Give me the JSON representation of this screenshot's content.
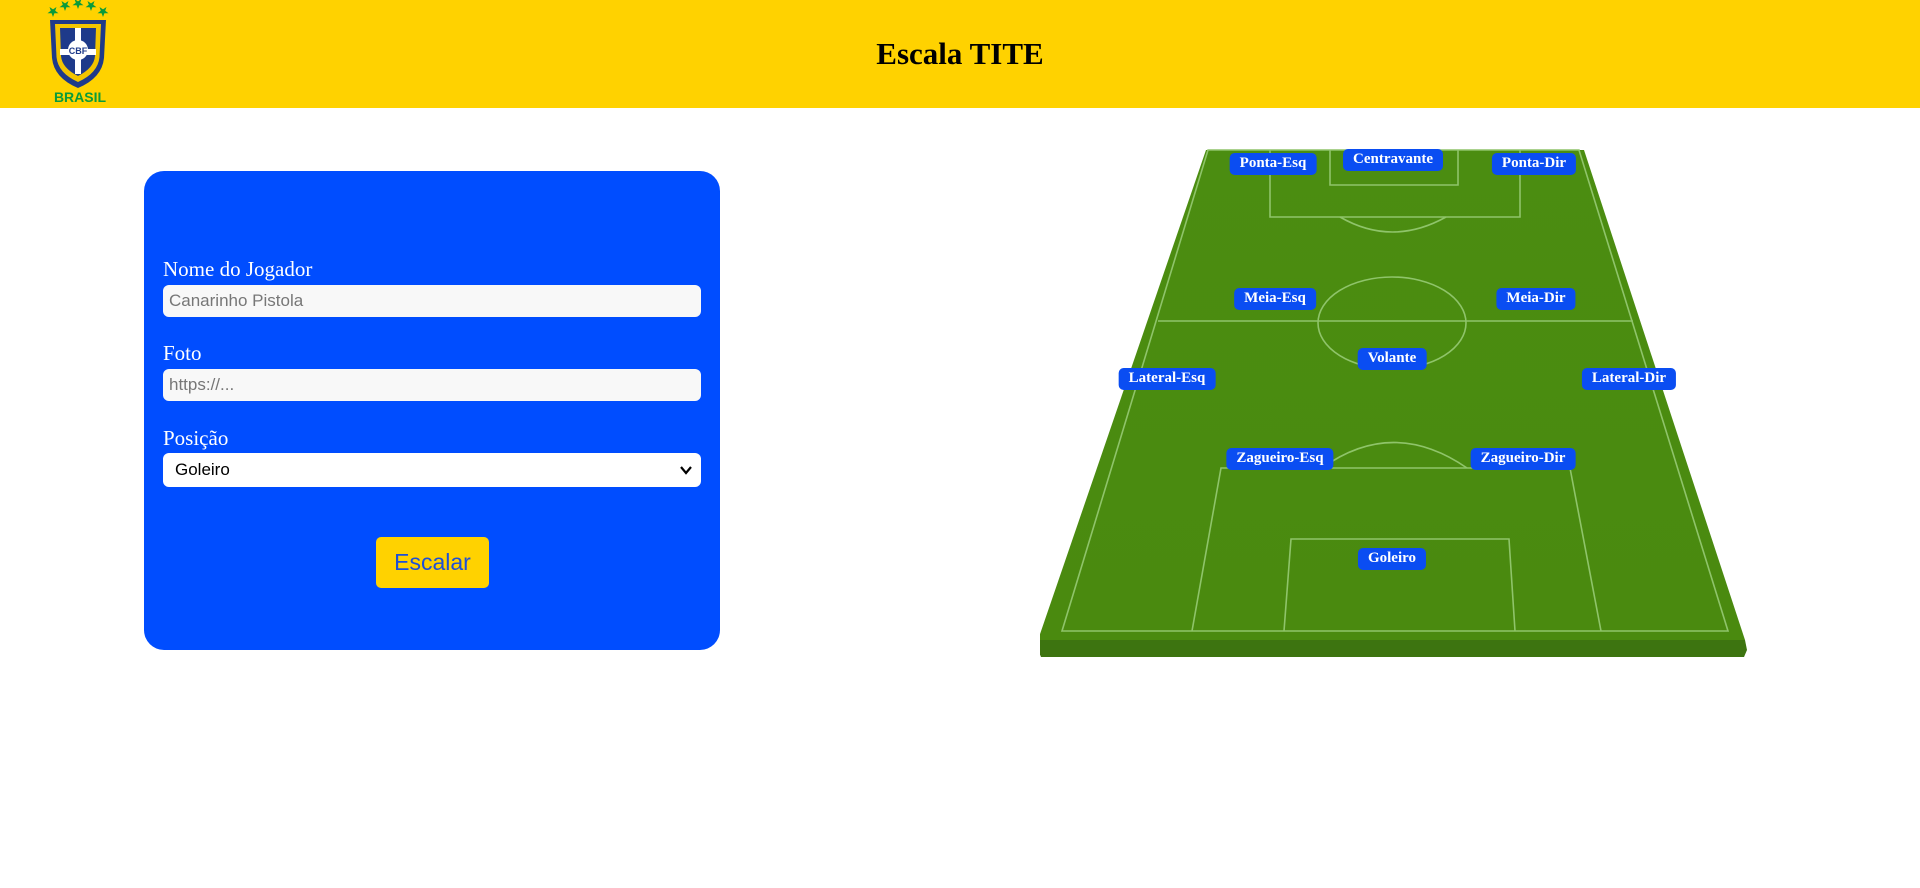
{
  "header": {
    "title": "Escala TITE",
    "logo": {
      "badge_text": "CBF",
      "caption": "BRASIL"
    },
    "background_color": "#ffd200"
  },
  "form": {
    "background_color": "#004dff",
    "name_label": "Nome do Jogador",
    "name_placeholder": "Canarinho Pistola",
    "photo_label": "Foto",
    "photo_placeholder": "https://...",
    "position_label": "Posição",
    "position_selected": "Goleiro",
    "submit_label": "Escalar"
  },
  "pitch": {
    "grass_color": "#4e8f12",
    "positions": {
      "ponta_esq": "Ponta-Esq",
      "centravante": "Centravante",
      "ponta_dir": "Ponta-Dir",
      "meia_esq": "Meia-Esq",
      "meia_dir": "Meia-Dir",
      "volante": "Volante",
      "lateral_esq": "Lateral-Esq",
      "lateral_dir": "Lateral-Dir",
      "zagueiro_esq": "Zagueiro-Esq",
      "zagueiro_dir": "Zagueiro-Dir",
      "goleiro": "Goleiro"
    }
  }
}
